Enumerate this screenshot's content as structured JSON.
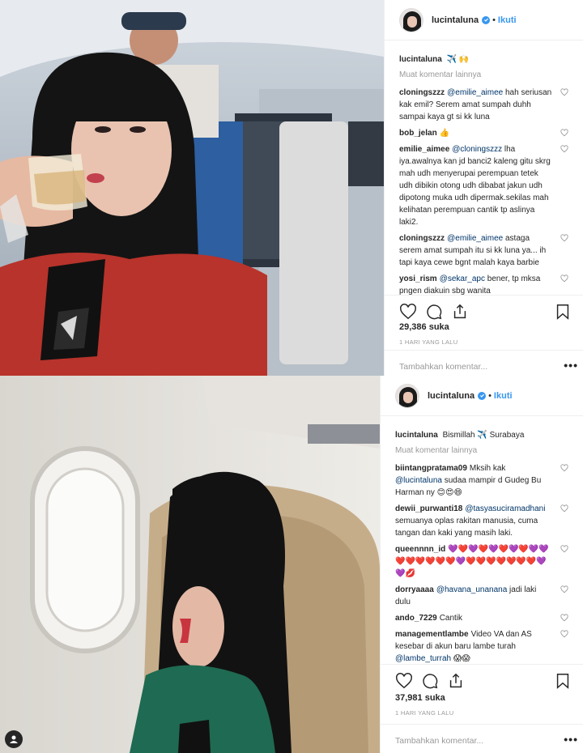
{
  "post1": {
    "username": "lucintaluna",
    "follow_label": "Ikuti",
    "caption_user": "lucintaluna",
    "caption_text": "✈️ 🙌",
    "load_more": "Muat komentar lainnya",
    "comments": [
      {
        "user": "cloningszzz",
        "mention": "@emilie_aimee",
        "text": " hah seriusan kak emil? Serem amat sumpah duhh sampai kaya gt si kk luna"
      },
      {
        "user": "bob_jelan",
        "mention": "",
        "text": "👍"
      },
      {
        "user": "emilie_aimee",
        "mention": "@cloningszzz",
        "text": " lha iya.awalnya kan jd banci2 kaleng gitu skrg mah udh menyerupai perempuan tetek udh dibikin otong udh dibabat jakun udh dipotong muka udh dipermak.sekilas mah kelihatan perempuan cantik tp aslinya laki2."
      },
      {
        "user": "cloningszzz",
        "mention": "@emilie_aimee",
        "text": " astaga serem amat sumpah itu si kk luna ya... ih tapi kaya cewe bgnt malah kaya barbie"
      },
      {
        "user": "yosi_rism",
        "mention": "@sekar_apc",
        "text": " bener, tp mksa pngen diakuin sbg wanita"
      }
    ],
    "likes": "29,386 suka",
    "time": "1 HARI YANG LALU",
    "add_comment": "Tambahkan komentar...",
    "more": "•••"
  },
  "post2": {
    "username": "lucintaluna",
    "follow_label": "Ikuti",
    "caption_user": "lucintaluna",
    "caption_text": "Bismillah ✈️ Surabaya",
    "load_more": "Muat komentar lainnya",
    "comments": [
      {
        "user": "biintangpratama09",
        "mention": "",
        "text": "Mksih kak ",
        "mention2": "@lucintaluna",
        "text2": " sudaa mampir d Gudeg Bu Harman ny 😊😍😄"
      },
      {
        "user": "dewii_purwanti18",
        "mention": "",
        "text": "",
        "mention2": "@tasyasuciramadhani",
        "text2": " semuanya oplas rakitan manusia, cuma tangan dan kaki yang masih laki."
      },
      {
        "user": "queennnn_id",
        "mention": "",
        "text": "💜❤️💜❤️💜❤️💜❤️💜💜❤️❤️❤️❤️❤️❤️💜❤️❤️❤️❤️❤️❤️❤️💜💜💋",
        "mention2": "",
        "text2": ""
      },
      {
        "user": "dorryaaaa",
        "mention": "",
        "text": "",
        "mention2": "@havana_unanana",
        "text2": " jadi laki dulu"
      },
      {
        "user": "ando_7229",
        "mention": "",
        "text": "Cantik",
        "mention2": "",
        "text2": ""
      },
      {
        "user": "managementlambe",
        "mention": "",
        "text": "Video VA dan AS kesebar di akun baru lambe turah ",
        "mention2": "@lambe_turrah",
        "text2": " 😱😱"
      }
    ],
    "likes": "37,981 suka",
    "time": "1 HARI YANG LALU",
    "add_comment": "Tambahkan komentar...",
    "more": "•••"
  }
}
